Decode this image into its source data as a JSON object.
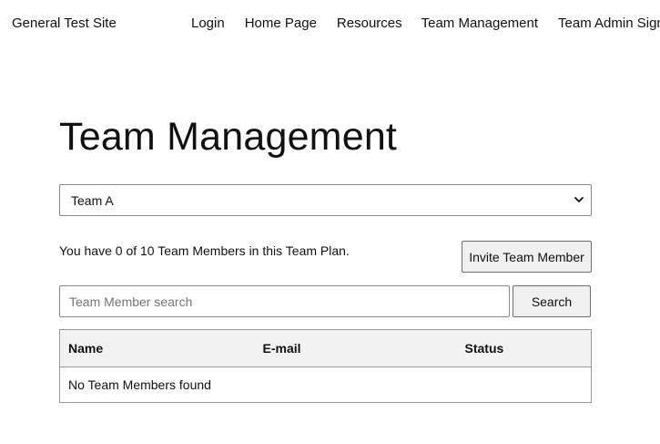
{
  "header": {
    "brand": "General Test Site",
    "nav": [
      "Login",
      "Home Page",
      "Resources",
      "Team Management",
      "Team Admin Sign Up"
    ]
  },
  "main": {
    "title": "Team Management",
    "team_select": {
      "selected": "Team A"
    },
    "summary": "You have 0 of 10 Team Members in this Team Plan.",
    "invite_label": "Invite Team Member",
    "search": {
      "placeholder": "Team Member search",
      "value": "",
      "button_label": "Search"
    },
    "table": {
      "columns": [
        "Name",
        "E-mail",
        "Status"
      ],
      "empty_message": "No Team Members found"
    }
  }
}
